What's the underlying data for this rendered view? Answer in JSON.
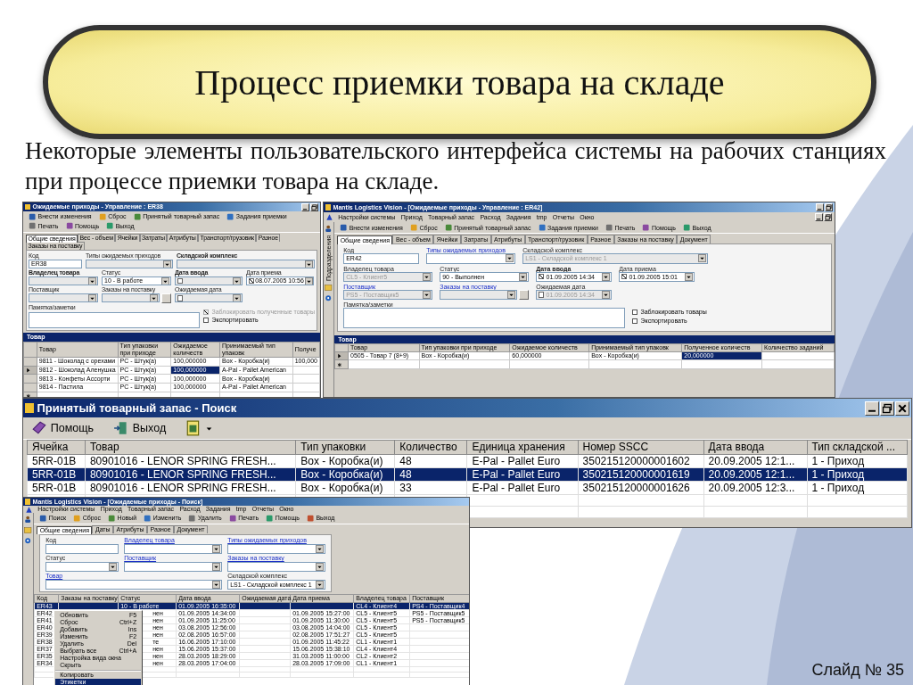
{
  "slide": {
    "title": "Процесс приемки товара на складе",
    "intro": "Некоторые элементы пользовательского интерфейса системы на рабочих станциях при процессе приемки товара на складе.",
    "slide_number": "Слайд № 35"
  },
  "windows": [
    {
      "kind": "form",
      "title": "Ожидаемые приходы - Управление : ER38",
      "toolbar": [
        "Внести изменения",
        "Сброс",
        "Принятый товарный запас",
        "Задания приемки",
        "Печать",
        "Помощь",
        "Выход"
      ],
      "tabs": [
        {
          "label": "Общие сведения",
          "selected": true
        },
        {
          "label": "Вес - объем",
          "selected": false
        },
        {
          "label": "Ячейки",
          "selected": false
        },
        {
          "label": "Затраты",
          "selected": false
        },
        {
          "label": "Атрибуты",
          "selected": false
        },
        {
          "label": "Транспорт/грузовик",
          "selected": false
        },
        {
          "label": "Разное",
          "selected": false
        },
        {
          "label": "Заказы на поставку",
          "selected": false
        }
      ],
      "form": {
        "rows": [
          [
            {
              "kind": "text",
              "label": "Код",
              "link": false,
              "bold": false,
              "disabled": false,
              "value": "ER38"
            },
            {
              "kind": "combo",
              "label": "Типы ожидаемых приходов",
              "link": false,
              "bold": false,
              "disabled": true
            },
            {
              "kind": "combo",
              "label": "Складской комплекс",
              "link": false,
              "bold": true,
              "disabled": true
            }
          ],
          [
            {
              "kind": "combo",
              "label": "Владелец товара",
              "link": false,
              "bold": true,
              "disabled": true
            },
            {
              "kind": "combo",
              "label": "Статус",
              "link": false,
              "bold": false,
              "disabled": false,
              "value": "10 - В работе"
            },
            {
              "kind": "date",
              "label": "Дата ввода",
              "link": false,
              "bold": true,
              "disabled": true,
              "checked": false
            },
            {
              "kind": "date",
              "label": "Дата приема",
              "link": false,
              "bold": false,
              "disabled": false,
              "checked": true,
              "value": "08.07.2005 10:56"
            }
          ],
          [
            {
              "kind": "combo",
              "label": "Поставщик",
              "link": false,
              "bold": false,
              "disabled": true
            },
            {
              "kind": "combo_button",
              "label": "Заказы на поставку",
              "link": false,
              "bold": false,
              "disabled": true
            },
            {
              "kind": "date",
              "label": "Ожидаемая дата",
              "link": false,
              "bold": false,
              "disabled": true,
              "checked": false
            }
          ]
        ],
        "notes_label": "Памятка/заметки",
        "checkboxes": [
          {
            "label": "Заблокировать полученные товары",
            "checked": true,
            "disabled": true
          },
          {
            "label": "Экспортировать",
            "checked": false,
            "disabled": false
          }
        ]
      },
      "grid": {
        "title": "Товар",
        "columns": [
          "Товар",
          "Тип упаковки при приходе",
          "Ожидаемое количеств",
          "Принимаемый тип упаковк",
          "Получе"
        ],
        "rows": [
          {
            "current": false,
            "cells": [
              {
                "text": "9811 - Шоколад с орехами",
                "selected": false
              },
              {
                "text": "PC - Штук(а)",
                "selected": false
              },
              {
                "text": "100,000000",
                "selected": false
              },
              {
                "text": "Box - Коробка(и)",
                "selected": false
              },
              {
                "text": "100,000",
                "selected": false
              }
            ]
          },
          {
            "current": true,
            "cells": [
              {
                "text": "9812 - Шоколад Аленушка",
                "selected": false
              },
              {
                "text": "PC - Штук(а)",
                "selected": false
              },
              {
                "text": "100,000000",
                "selected": true
              },
              {
                "text": "A-Pal - Pallet American",
                "selected": false
              },
              {
                "text": "",
                "selected": false
              }
            ]
          },
          {
            "current": false,
            "cells": [
              {
                "text": "9813 - Конфеты Ассорти",
                "selected": false
              },
              {
                "text": "PC - Штук(а)",
                "selected": false
              },
              {
                "text": "100,000000",
                "selected": false
              },
              {
                "text": "Box - Коробка(и)",
                "selected": false
              },
              {
                "text": "",
                "selected": false
              }
            ]
          },
          {
            "current": false,
            "cells": [
              {
                "text": "9814 - Пастила",
                "selected": false
              },
              {
                "text": "PC - Штук(а)",
                "selected": false
              },
              {
                "text": "100,000000",
                "selected": false
              },
              {
                "text": "A-Pal - Pallet American",
                "selected": false
              },
              {
                "text": "",
                "selected": false
              }
            ]
          }
        ]
      }
    },
    {
      "kind": "form",
      "title": "Mantis Logistics Vision - [Ожидаемые приходы - Управление : ER42]",
      "menu": [
        "Настройки системы",
        "Приход",
        "Товарный запас",
        "Расход",
        "Задания",
        "tmp",
        "Отчеты",
        "Окно"
      ],
      "sidebar_label": "Подразделения",
      "toolbar": [
        "Внести изменения",
        "Сброс",
        "Принятый товарный запас",
        "Задания приемки",
        "Печать",
        "Помощь",
        "Выход"
      ],
      "tabs": [
        {
          "label": "Общие сведения",
          "selected": true
        },
        {
          "label": "Вес - объем",
          "selected": false
        },
        {
          "label": "Ячейки",
          "selected": false
        },
        {
          "label": "Затраты",
          "selected": false
        },
        {
          "label": "Атрибуты",
          "selected": false
        },
        {
          "label": "Транспорт/грузовик",
          "selected": false
        },
        {
          "label": "Разное",
          "selected": false
        },
        {
          "label": "Заказы на поставку",
          "selected": false
        },
        {
          "label": "Документ",
          "selected": false
        }
      ],
      "form": {
        "rows": [
          [
            {
              "kind": "text",
              "label": "Код",
              "link": false,
              "bold": false,
              "disabled": false,
              "value": "ER42"
            },
            {
              "kind": "combo",
              "label": "Типы ожидаемых приходов",
              "link": true,
              "bold": false,
              "disabled": false
            },
            {
              "kind": "combo",
              "label": "Складской комплекс",
              "link": false,
              "bold": false,
              "disabled": true,
              "value": "LS1 - Складской комплекс 1"
            }
          ],
          [
            {
              "kind": "combo",
              "label": "Владелец товара",
              "link": false,
              "bold": false,
              "disabled": true,
              "value": "CL5 - Клиент5"
            },
            {
              "kind": "combo",
              "label": "Статус",
              "link": false,
              "bold": false,
              "disabled": false,
              "value": "90 - Выполнен"
            },
            {
              "kind": "date",
              "label": "Дата ввода",
              "link": false,
              "bold": true,
              "disabled": false,
              "checked": true,
              "value": "01.09.2005 14:34"
            },
            {
              "kind": "date",
              "label": "Дата приема",
              "link": false,
              "bold": false,
              "disabled": false,
              "checked": true,
              "value": "01.09.2005 15:01"
            }
          ],
          [
            {
              "kind": "combo",
              "label": "Поставщик",
              "link": true,
              "bold": false,
              "disabled": true,
              "value": "PS5 - Поставщик5"
            },
            {
              "kind": "combo_button",
              "label": "Заказы на поставку",
              "link": true,
              "bold": false,
              "disabled": true
            },
            {
              "kind": "date",
              "label": "Ожидаемая дата",
              "link": false,
              "bold": false,
              "disabled": true,
              "checked": false,
              "value": "01.09.2005 14:34"
            }
          ]
        ],
        "notes_label": "Памятка/заметки",
        "checkboxes": [
          {
            "label": "Заблокировать товары",
            "checked": false,
            "disabled": false
          },
          {
            "label": "Экспортировать",
            "checked": false,
            "disabled": false
          }
        ]
      },
      "grid": {
        "title": "Товар",
        "columns": [
          "Товар",
          "Тип упаковки при приходе",
          "Ожидаемое количеств",
          "Принимаемый тип упаковк",
          "Полученное количеств",
          "Количество заданий"
        ],
        "rows": [
          {
            "current": true,
            "cells": [
              {
                "text": "0505 - Товар 7 (8+9)",
                "selected": false
              },
              {
                "text": "Box - Коробка(и)",
                "selected": false
              },
              {
                "text": "60,000000",
                "selected": false
              },
              {
                "text": "Box - Коробка(и)",
                "selected": false
              },
              {
                "text": "20,000000",
                "selected": true
              },
              {
                "text": "",
                "selected": false
              }
            ]
          }
        ]
      }
    },
    {
      "kind": "stock_search",
      "title": "Принятый товарный запас - Поиск",
      "toolbar": [
        "Помощь",
        "Выход"
      ],
      "columns": [
        "Ячейка",
        "Товар",
        "Тип упаковки",
        "Количество",
        "Единица хранения",
        "Номер SSCC",
        "Дата ввода",
        "Тип складской ..."
      ],
      "rows": [
        {
          "selected": false,
          "cells": [
            "5RR-01B",
            "80901016 - LENOR SPRING FRESH...",
            "Box - Коробка(и)",
            "48",
            "E-Pal - Pallet Euro",
            "350215120000001602",
            "20.09.2005 12:1...",
            "1 - Приход"
          ]
        },
        {
          "selected": true,
          "cells": [
            "5RR-01B",
            "80901016 - LENOR SPRING FRESH...",
            "Box - Коробка(и)",
            "48",
            "E-Pal - Pallet Euro",
            "350215120000001619",
            "20.09.2005 12:1...",
            "1 - Приход"
          ]
        },
        {
          "selected": false,
          "cells": [
            "5RR-01B",
            "80901016 - LENOR SPRING FRESH...",
            "Box - Коробка(и)",
            "33",
            "E-Pal - Pallet Euro",
            "350215120000001626",
            "20.09.2005 12:3...",
            "1 - Приход"
          ]
        }
      ]
    },
    {
      "kind": "search",
      "title": "Mantis Logistics Vision - [Ожидаемые приходы - Поиск]",
      "menu": [
        "Настройки системы",
        "Приход",
        "Товарный запас",
        "Расход",
        "Задания",
        "tmp",
        "Отчеты",
        "Окно"
      ],
      "toolbar": [
        "Поиск",
        "Сброс",
        "Новый",
        "Изменить",
        "Удалить",
        "Печать",
        "Помощь",
        "Выход"
      ],
      "tabs": [
        {
          "label": "Общие сведения",
          "selected": true
        },
        {
          "label": "Даты",
          "selected": false
        },
        {
          "label": "Атрибуты",
          "selected": false
        },
        {
          "label": "Разное",
          "selected": false
        },
        {
          "label": "Документ",
          "selected": false
        }
      ],
      "filters": [
        {
          "label": "Код",
          "link": false
        },
        {
          "label": "Владелец товара",
          "link": true
        },
        {
          "label": "Типы ожидаемых приходов",
          "link": true
        },
        {
          "label": "Статус",
          "link": false
        },
        {
          "label": "Поставщик",
          "link": true
        },
        {
          "label": "Заказы на поставку",
          "link": true
        },
        {
          "label": "Товар",
          "link": true
        },
        {
          "label": "Складской комплекс",
          "link": false,
          "value": "LS1 - Складской комплекс 1"
        }
      ],
      "columns": [
        "Код",
        "Заказы на поставку",
        "Статус",
        "Дата ввода",
        "Ожидаемая дата",
        "Дата приема",
        "Владелец товара",
        "Поставщик"
      ],
      "rows": [
        {
          "selected": true,
          "cells": [
            "ER43",
            "",
            "10 - В работе",
            "01.09.2005 16:35:00",
            "",
            "",
            "CL4 - Клиент4",
            "PS4 - Поставщик4"
          ]
        },
        {
          "selected": false,
          "cells": [
            "ER42",
            "",
            "нен",
            "01.09.2005 14:34:00",
            "",
            "01.09.2005 15:27:00",
            "CL5 - Клиент5",
            "PS5 - Поставщик5"
          ]
        },
        {
          "selected": false,
          "cells": [
            "ER41",
            "",
            "нен",
            "01.09.2005 11:25:00",
            "",
            "01.09.2005 11:30:00",
            "CL5 - Клиент5",
            "PS5 - Поставщик5"
          ]
        },
        {
          "selected": false,
          "cells": [
            "ER40",
            "",
            "нен",
            "03.08.2005 12:56:00",
            "",
            "03.08.2005 14:04:00",
            "CL5 - Клиент5",
            ""
          ]
        },
        {
          "selected": false,
          "cells": [
            "ER39",
            "",
            "нен",
            "02.08.2005 16:57:00",
            "",
            "02.08.2005 17:51:27",
            "CL5 - Клиент5",
            ""
          ]
        },
        {
          "selected": false,
          "cells": [
            "ER38",
            "",
            "те",
            "16.06.2005 17:10:00",
            "",
            "01.09.2005 11:45:22",
            "CL1 - Клиент1",
            ""
          ]
        },
        {
          "selected": false,
          "cells": [
            "ER37",
            "",
            "нен",
            "15.06.2005 15:37:00",
            "",
            "15.06.2005 15:38:10",
            "CL4 - Клиент4",
            ""
          ]
        },
        {
          "selected": false,
          "cells": [
            "ER35",
            "",
            "нен",
            "28.03.2005 18:29:00",
            "",
            "31.03.2005 11:00:00",
            "CL2 - Клиент2",
            ""
          ]
        },
        {
          "selected": false,
          "cells": [
            "ER34",
            "",
            "нен",
            "28.03.2005 17:04:00",
            "",
            "28.03.2005 17:09:00",
            "CL1 - Клиент1",
            ""
          ]
        }
      ],
      "context_menu": [
        {
          "label": "Обновить",
          "shortcut": "F5",
          "separator_before": false,
          "selected": false
        },
        {
          "label": "Сброс",
          "shortcut": "Ctrl+Z",
          "separator_before": false,
          "selected": false
        },
        {
          "label": "Добавить",
          "shortcut": "Ins",
          "separator_before": false,
          "selected": false
        },
        {
          "label": "Изменить",
          "shortcut": "F2",
          "separator_before": false,
          "selected": false
        },
        {
          "label": "Удалить",
          "shortcut": "Del",
          "separator_before": false,
          "selected": false
        },
        {
          "label": "Выбрать все",
          "shortcut": "Ctrl+A",
          "separator_before": false,
          "selected": false
        },
        {
          "label": "Настройка вида окна",
          "separator_before": false,
          "selected": false
        },
        {
          "label": "Скрыть",
          "separator_before": false,
          "selected": false
        },
        {
          "label": "Копировать",
          "separator_before": true,
          "selected": false
        },
        {
          "label": "Этикетки",
          "separator_before": false,
          "selected": true
        }
      ]
    }
  ]
}
